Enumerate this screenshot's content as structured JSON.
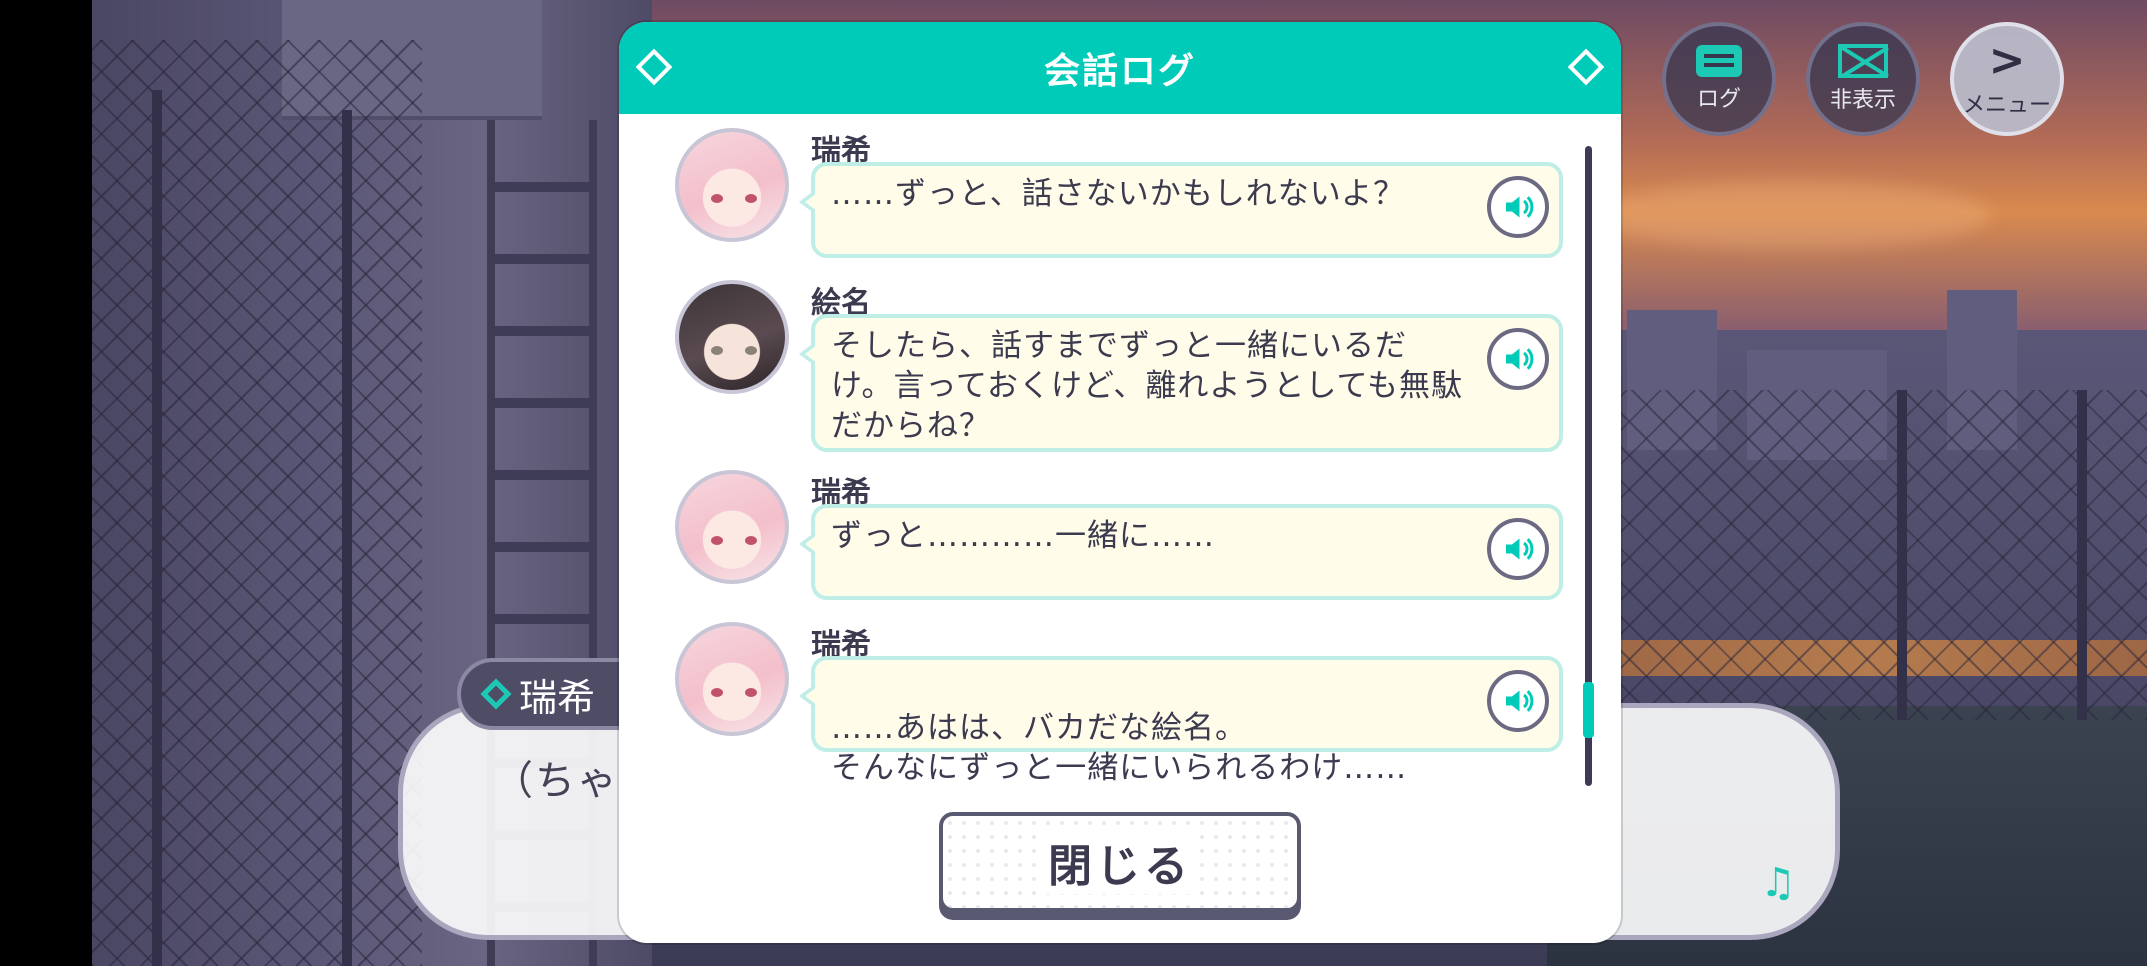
{
  "modal": {
    "title": "会話ログ",
    "close_label": "閉じる",
    "entries": [
      {
        "speaker": "瑞希",
        "text": "……ずっと、話さないかもしれないよ？",
        "avatar": "mizuki-avatar"
      },
      {
        "speaker": "絵名",
        "text": "そしたら、話すまでずっと一緒にいるだけ。言っておくけど、離れようとしても無駄だからね？",
        "avatar": "ena-avatar"
      },
      {
        "speaker": "瑞希",
        "text": "ずっと…………一緒に……",
        "avatar": "mizuki-avatar"
      },
      {
        "speaker": "瑞希",
        "text": "……あはは、バカだな絵名。\nそんなにずっと一緒にいられるわけ……",
        "avatar": "mizuki-avatar"
      }
    ]
  },
  "top_buttons": {
    "log_label": "ログ",
    "hide_label": "非表示",
    "menu_label": "メニュー"
  },
  "dialogue": {
    "speaker": "瑞希",
    "text": "（ちゃん"
  },
  "colors": {
    "accent": "#00cbb9",
    "bubble_bg": "#fffde9",
    "bubble_border": "#bfeee6",
    "text_dark": "#3b3a4f"
  },
  "icons": {
    "voice": "speaker-icon",
    "log": "chat-bubble-icon",
    "hide": "hide-window-icon",
    "menu": "chevron-right-icon",
    "music": "music-note-icon"
  }
}
